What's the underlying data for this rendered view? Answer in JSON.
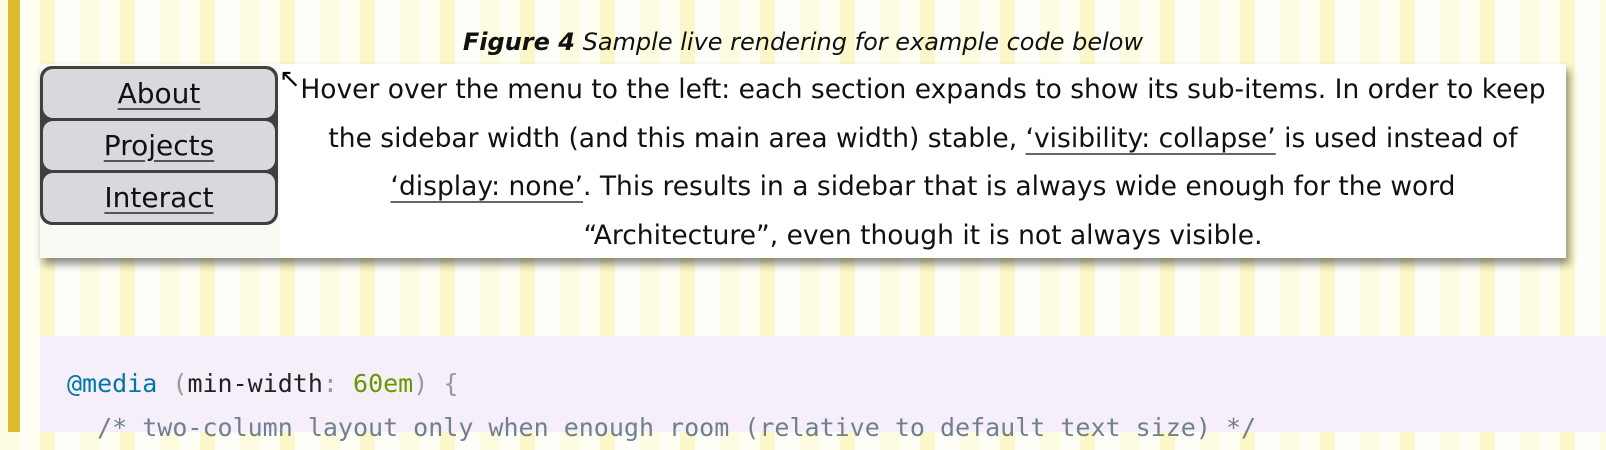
{
  "caption": {
    "label": "Figure 4",
    "text": "Sample live rendering for example code below"
  },
  "menu": [
    "About",
    "Projects",
    "Interact"
  ],
  "main": {
    "p1": "Hover over the menu to the left: each section expands to show its sub-items. In order to keep the sidebar width (and this main area width) stable, ",
    "link1": "‘visibility: collapse’",
    "p2": " is used instead of ",
    "link2": "‘display: none’",
    "p3": ". This results in a sidebar that is always wide enough for the word “Architecture”, even though it is not always visible."
  },
  "code": {
    "at": "@media",
    "open": "(",
    "prop": "min-width",
    "colon": ":",
    "value": "60em",
    "close": ")",
    "brace": "{",
    "comment": "  /* two-column layout only when enough room (relative to default text size) */"
  },
  "colors": {
    "accent_bar": "#dcbc2c",
    "keyword": "#0077aa",
    "number": "#669900"
  },
  "icons": {
    "cursor": "arrow-cursor-icon"
  }
}
